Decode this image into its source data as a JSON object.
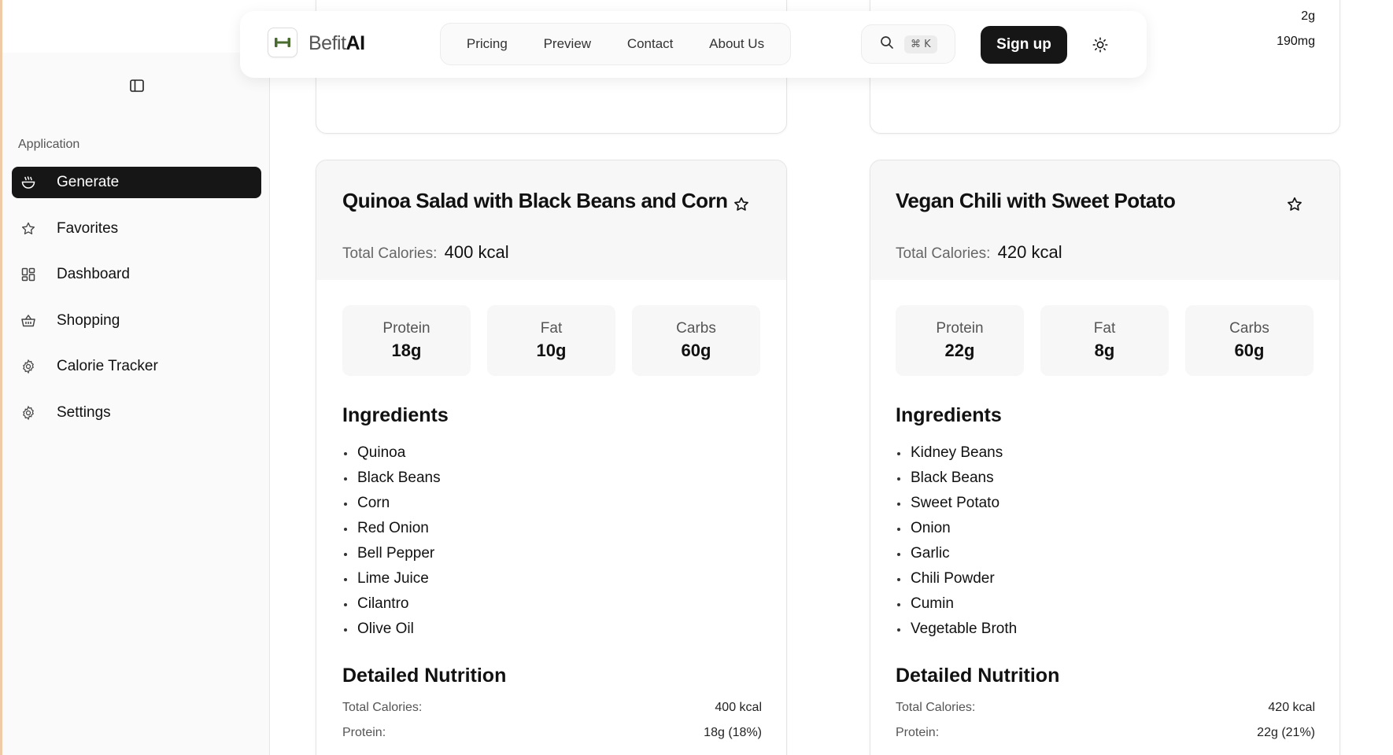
{
  "header": {
    "brand_part1": "Befit",
    "brand_part2": "AI",
    "nav": [
      "Pricing",
      "Preview",
      "Contact",
      "About Us"
    ],
    "search_shortcut": "⌘ K",
    "signup_label": "Sign up"
  },
  "sidebar": {
    "section_label": "Application",
    "items": [
      {
        "label": "Generate",
        "icon": "bowl-icon",
        "active": true
      },
      {
        "label": "Favorites",
        "icon": "star-icon",
        "active": false
      },
      {
        "label": "Dashboard",
        "icon": "dashboard-icon",
        "active": false
      },
      {
        "label": "Shopping",
        "icon": "basket-icon",
        "active": false
      },
      {
        "label": "Calorie Tracker",
        "icon": "gear-icon",
        "active": false
      },
      {
        "label": "Settings",
        "icon": "gear-icon",
        "active": false
      }
    ]
  },
  "top_cards": {
    "right_values": [
      "2g",
      "190mg"
    ]
  },
  "recipes": [
    {
      "title": "Quinoa Salad with Black Beans and Corn",
      "calories_label": "Total Calories:",
      "calories": "400 kcal",
      "macros": [
        {
          "name": "Protein",
          "value": "18g"
        },
        {
          "name": "Fat",
          "value": "10g"
        },
        {
          "name": "Carbs",
          "value": "60g"
        }
      ],
      "ingredients_title": "Ingredients",
      "ingredients": [
        "Quinoa",
        "Black Beans",
        "Corn",
        "Red Onion",
        "Bell Pepper",
        "Lime Juice",
        "Cilantro",
        "Olive Oil"
      ],
      "nutrition_title": "Detailed Nutrition",
      "nutrition": [
        {
          "label": "Total Calories:",
          "value": "400 kcal"
        },
        {
          "label": "Protein:",
          "value": "18g (18%)"
        }
      ]
    },
    {
      "title": "Vegan Chili with Sweet Potato",
      "calories_label": "Total Calories:",
      "calories": "420 kcal",
      "macros": [
        {
          "name": "Protein",
          "value": "22g"
        },
        {
          "name": "Fat",
          "value": "8g"
        },
        {
          "name": "Carbs",
          "value": "60g"
        }
      ],
      "ingredients_title": "Ingredients",
      "ingredients": [
        "Kidney Beans",
        "Black Beans",
        "Sweet Potato",
        "Onion",
        "Garlic",
        "Chili Powder",
        "Cumin",
        "Vegetable Broth"
      ],
      "nutrition_title": "Detailed Nutrition",
      "nutrition": [
        {
          "label": "Total Calories:",
          "value": "420 kcal"
        },
        {
          "label": "Protein:",
          "value": "22g (21%)"
        }
      ]
    }
  ],
  "colors": {
    "accent_dark": "#161616",
    "logo_green": "#4a6b2f"
  }
}
